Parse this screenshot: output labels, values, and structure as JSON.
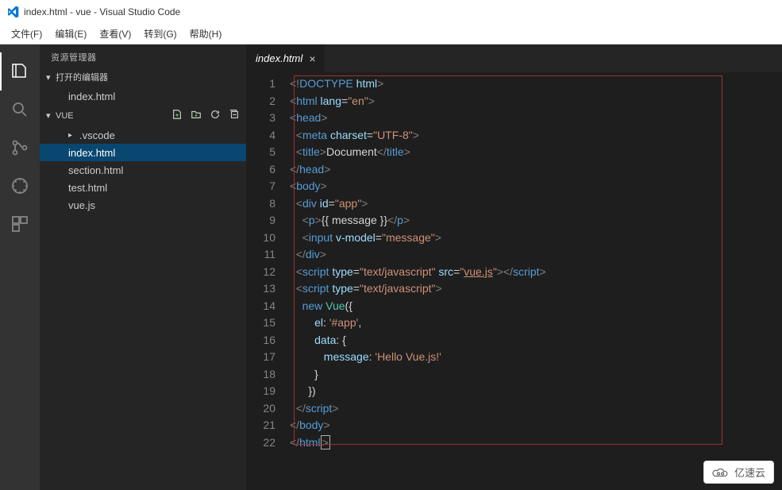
{
  "title": "index.html - vue - Visual Studio Code",
  "menu": {
    "file": "文件(F)",
    "edit": "编辑(E)",
    "view": "查看(V)",
    "goto": "转到(G)",
    "help": "帮助(H)"
  },
  "sidebar": {
    "header": "资源管理器",
    "sections": {
      "open_editors": "打开的编辑器",
      "open_editors_items": [
        "index.html"
      ],
      "project": "VUE",
      "tree": [
        {
          "label": ".vscode",
          "type": "folder"
        },
        {
          "label": "index.html",
          "type": "file",
          "selected": true
        },
        {
          "label": "section.html",
          "type": "file"
        },
        {
          "label": "test.html",
          "type": "file"
        },
        {
          "label": "vue.js",
          "type": "file"
        }
      ]
    },
    "icons": {
      "new_file": "new-file-icon",
      "new_folder": "new-folder-icon",
      "refresh": "refresh-icon",
      "collapse": "collapse-all-icon"
    }
  },
  "tab": {
    "label": "index.html",
    "close": "×"
  },
  "code_lines": [
    "<!DOCTYPE html>",
    "<html lang=\"en\">",
    "<head>",
    "  <meta charset=\"UTF-8\">",
    "  <title>Document</title>",
    "</head>",
    "<body>",
    "  <div id=\"app\">",
    "    <p>{{ message }}</p>",
    "    <input v-model=\"message\">",
    "  </div>",
    "  <script type=\"text/javascript\" src=\"vue.js\"></script>",
    "  <script type=\"text/javascript\">",
    "    new Vue({",
    "        el: '#app',",
    "        data: {",
    "           message: 'Hello Vue.js!'",
    "        }",
    "      })",
    "  </script>",
    "</body>",
    "</html>"
  ],
  "watermark": "亿速云"
}
